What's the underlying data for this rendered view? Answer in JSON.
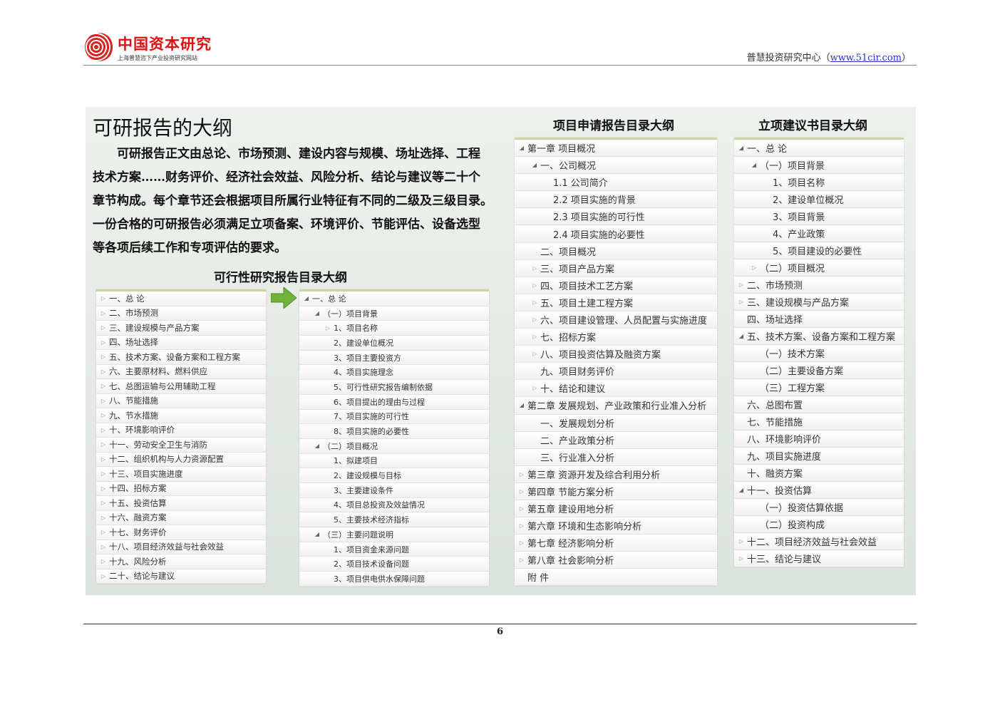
{
  "header": {
    "logo_title": "中国资本研究",
    "logo_sub": "上海普慧咨下产业投资研究网站",
    "right_text": "普慧投资研究中心（",
    "right_link": "www.51cir.com",
    "right_close": "）"
  },
  "main": {
    "heading": "可研报告的大纲",
    "paragraph": [
      "可研报告正文由总论、市场预测、建设内容与规模、场址选择、工程",
      "技术方案……财务评价、经济社会效益、风险分析、结论与建议等二十个",
      "章节构成。每个章节还会根据项目所属行业特征有不同的二级及三级目录。",
      "一份合格的可研报告必须满足立项备案、环境评价、节能评估、设备选型",
      "等各项后续工作和专项评估的要求。"
    ],
    "feasibility_title": "可行性研究报告目录大纲",
    "application_title": "项目申请报告目录大纲",
    "proposal_title": "立项建议书目录大纲"
  },
  "tree_feasibility": [
    {
      "label": "一、总 论",
      "marker": "▷",
      "indent": 0
    },
    {
      "label": "二、市场预测",
      "marker": "▷",
      "indent": 0
    },
    {
      "label": "三、建设规模与产品方案",
      "marker": "▷",
      "indent": 0
    },
    {
      "label": "四、场址选择",
      "marker": "▷",
      "indent": 0
    },
    {
      "label": "五、技术方案、设备方案和工程方案",
      "marker": "▷",
      "indent": 0
    },
    {
      "label": "六、主要原材料、燃料供应",
      "marker": "▷",
      "indent": 0
    },
    {
      "label": "七、总图运输与公用辅助工程",
      "marker": "▷",
      "indent": 0
    },
    {
      "label": "八、节能措施",
      "marker": "▷",
      "indent": 0
    },
    {
      "label": "九、节水措施",
      "marker": "▷",
      "indent": 0
    },
    {
      "label": "十、环境影响评价",
      "marker": "▷",
      "indent": 0
    },
    {
      "label": "十一、劳动安全卫生与消防",
      "marker": "▷",
      "indent": 0
    },
    {
      "label": "十二、组织机构与人力资源配置",
      "marker": "▷",
      "indent": 0
    },
    {
      "label": "十三、项目实施进度",
      "marker": "▷",
      "indent": 0
    },
    {
      "label": "十四、招标方案",
      "marker": "▷",
      "indent": 0
    },
    {
      "label": "十五、投资估算",
      "marker": "▷",
      "indent": 0
    },
    {
      "label": "十六、融资方案",
      "marker": "▷",
      "indent": 0
    },
    {
      "label": "十七、财务评价",
      "marker": "▷",
      "indent": 0
    },
    {
      "label": "十八、项目经济效益与社会效益",
      "marker": "▷",
      "indent": 0
    },
    {
      "label": "十九、风险分析",
      "marker": "▷",
      "indent": 0
    },
    {
      "label": "二十、结论与建议",
      "marker": "▷",
      "indent": 0
    }
  ],
  "tree_detail": [
    {
      "label": "一、总 论",
      "marker": "◢",
      "indent": 0
    },
    {
      "label": "（一）项目背景",
      "marker": "◢",
      "indent": 1
    },
    {
      "label": "1、项目名称",
      "marker": "▷",
      "indent": 2
    },
    {
      "label": "2、建设单位概况",
      "marker": "",
      "indent": 2
    },
    {
      "label": "3、项目主要投资方",
      "marker": "",
      "indent": 2
    },
    {
      "label": "4、项目实施理念",
      "marker": "",
      "indent": 2
    },
    {
      "label": "5、可行性研究报告编制依据",
      "marker": "",
      "indent": 2
    },
    {
      "label": "6、项目提出的理由与过程",
      "marker": "",
      "indent": 2
    },
    {
      "label": "7、项目实施的可行性",
      "marker": "",
      "indent": 2
    },
    {
      "label": "8、项目实施的必要性",
      "marker": "",
      "indent": 2
    },
    {
      "label": "（二）项目概况",
      "marker": "◢",
      "indent": 1
    },
    {
      "label": "1、拟建项目",
      "marker": "",
      "indent": 2
    },
    {
      "label": "2、建设规模与目标",
      "marker": "",
      "indent": 2
    },
    {
      "label": "3、主要建设条件",
      "marker": "",
      "indent": 2
    },
    {
      "label": "4、项目总投资及效益情况",
      "marker": "",
      "indent": 2
    },
    {
      "label": "5、主要技术经济指标",
      "marker": "",
      "indent": 2
    },
    {
      "label": "（三）主要问题说明",
      "marker": "◢",
      "indent": 1
    },
    {
      "label": "1、项目资金来源问题",
      "marker": "",
      "indent": 2
    },
    {
      "label": "2、项目技术设备问题",
      "marker": "",
      "indent": 2
    },
    {
      "label": "3、项目供电供水保障问题",
      "marker": "",
      "indent": 2
    }
  ],
  "tree_application": [
    {
      "label": "第一章 项目概况",
      "marker": "◢",
      "indent": 0
    },
    {
      "label": "一、公司概况",
      "marker": "◢",
      "indent": 1
    },
    {
      "label": "1.1 公司简介",
      "marker": "",
      "indent": 2
    },
    {
      "label": "2.2 项目实施的背景",
      "marker": "",
      "indent": 2
    },
    {
      "label": "2.3 项目实施的可行性",
      "marker": "",
      "indent": 2
    },
    {
      "label": "2.4 项目实施的必要性",
      "marker": "",
      "indent": 2
    },
    {
      "label": "二、项目概况",
      "marker": "",
      "indent": 1
    },
    {
      "label": "三、项目产品方案",
      "marker": "▷",
      "indent": 1
    },
    {
      "label": "四、项目技术工艺方案",
      "marker": "▷",
      "indent": 1
    },
    {
      "label": "五、项目土建工程方案",
      "marker": "▷",
      "indent": 1
    },
    {
      "label": "六、项目建设管理、人员配置与实施进度",
      "marker": "▷",
      "indent": 1
    },
    {
      "label": "七、招标方案",
      "marker": "▷",
      "indent": 1
    },
    {
      "label": "八、项目投资估算及融资方案",
      "marker": "▷",
      "indent": 1
    },
    {
      "label": "九、项目财务评价",
      "marker": "",
      "indent": 1
    },
    {
      "label": "十、结论和建议",
      "marker": "▷",
      "indent": 1
    },
    {
      "label": "第二章 发展规划、产业政策和行业准入分析",
      "marker": "◢",
      "indent": 0
    },
    {
      "label": "一、发展规划分析",
      "marker": "",
      "indent": 1
    },
    {
      "label": "二、产业政策分析",
      "marker": "",
      "indent": 1
    },
    {
      "label": "三、行业准入分析",
      "marker": "",
      "indent": 1
    },
    {
      "label": "第三章 资源开发及综合利用分析",
      "marker": "▷",
      "indent": 0
    },
    {
      "label": "第四章 节能方案分析",
      "marker": "▷",
      "indent": 0
    },
    {
      "label": "第五章 建设用地分析",
      "marker": "▷",
      "indent": 0
    },
    {
      "label": "第六章 环境和生态影响分析",
      "marker": "▷",
      "indent": 0
    },
    {
      "label": "第七章 经济影响分析",
      "marker": "▷",
      "indent": 0
    },
    {
      "label": "第八章 社会影响分析",
      "marker": "▷",
      "indent": 0
    },
    {
      "label": "附 件",
      "marker": "",
      "indent": 0
    }
  ],
  "tree_proposal": [
    {
      "label": "一、总 论",
      "marker": "◢",
      "indent": 0
    },
    {
      "label": "（一）项目背景",
      "marker": "◢",
      "indent": 1
    },
    {
      "label": "1、项目名称",
      "marker": "",
      "indent": 2
    },
    {
      "label": "2、建设单位概况",
      "marker": "",
      "indent": 2
    },
    {
      "label": "3、项目背景",
      "marker": "",
      "indent": 2
    },
    {
      "label": "4、产业政策",
      "marker": "",
      "indent": 2
    },
    {
      "label": "5、项目建设的必要性",
      "marker": "",
      "indent": 2
    },
    {
      "label": "（二）项目概况",
      "marker": "▷",
      "indent": 1
    },
    {
      "label": "二、市场预测",
      "marker": "▷",
      "indent": 0
    },
    {
      "label": "三、建设规模与产品方案",
      "marker": "▷",
      "indent": 0
    },
    {
      "label": "四、场址选择",
      "marker": "",
      "indent": 0
    },
    {
      "label": "五、技术方案、设备方案和工程方案",
      "marker": "◢",
      "indent": 0
    },
    {
      "label": "（一）技术方案",
      "marker": "",
      "indent": 1
    },
    {
      "label": "（二）主要设备方案",
      "marker": "",
      "indent": 1
    },
    {
      "label": "（三）工程方案",
      "marker": "",
      "indent": 1
    },
    {
      "label": "六、总图布置",
      "marker": "",
      "indent": 0
    },
    {
      "label": "七、节能措施",
      "marker": "",
      "indent": 0
    },
    {
      "label": "八、环境影响评价",
      "marker": "",
      "indent": 0
    },
    {
      "label": "九、项目实施进度",
      "marker": "",
      "indent": 0
    },
    {
      "label": "十、融资方案",
      "marker": "",
      "indent": 0
    },
    {
      "label": "十一、投资估算",
      "marker": "◢",
      "indent": 0
    },
    {
      "label": "（一）投资估算依据",
      "marker": "",
      "indent": 1
    },
    {
      "label": "（二）投资构成",
      "marker": "",
      "indent": 1
    },
    {
      "label": "十二、项目经济效益与社会效益",
      "marker": "▷",
      "indent": 0
    },
    {
      "label": "十三、结论与建议",
      "marker": "▷",
      "indent": 0
    }
  ],
  "footer": {
    "page_number": "6"
  }
}
